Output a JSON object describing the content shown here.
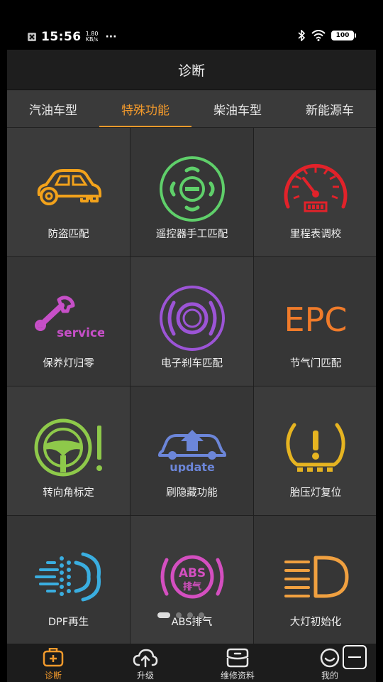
{
  "status_bar": {
    "time": "15:56",
    "speed_value": "1.80",
    "speed_unit": "KB/s",
    "more": "···",
    "battery": "100"
  },
  "header": {
    "title": "诊断"
  },
  "tabs": [
    {
      "label": "汽油车型",
      "active": false
    },
    {
      "label": "特殊功能",
      "active": true
    },
    {
      "label": "柴油车型",
      "active": false
    },
    {
      "label": "新能源车",
      "active": false
    }
  ],
  "features": [
    {
      "label": "防盗匹配",
      "icon": "car-key-icon",
      "color": "#f2a21b"
    },
    {
      "label": "遥控器手工匹配",
      "icon": "remote-control-icon",
      "color": "#5fcf6a"
    },
    {
      "label": "里程表调校",
      "icon": "odometer-icon",
      "color": "#e2222a"
    },
    {
      "label": "保养灯归零",
      "icon": "service-wrench-icon",
      "color": "#c64fc7"
    },
    {
      "label": "电子刹车匹配",
      "icon": "electronic-brake-icon",
      "color": "#9c54d6"
    },
    {
      "label": "节气门匹配",
      "icon": "epc-icon",
      "color": "#f07b2a",
      "icon_text": "EPC"
    },
    {
      "label": "转向角标定",
      "icon": "steering-wheel-icon",
      "color": "#8ec94a"
    },
    {
      "label": "刷隐藏功能",
      "icon": "car-update-icon",
      "color": "#6c86d9",
      "icon_text": "update"
    },
    {
      "label": "胎压灯复位",
      "icon": "tire-pressure-icon",
      "color": "#e6b421"
    },
    {
      "label": "DPF再生",
      "icon": "dpf-icon",
      "color": "#3aaee0"
    },
    {
      "label": "ABS排气",
      "icon": "abs-bleed-icon",
      "color": "#d44fc0",
      "icon_text": "ABS",
      "icon_subtext": "排气"
    },
    {
      "label": "大灯初始化",
      "icon": "headlight-icon",
      "color": "#f0a040"
    }
  ],
  "bottom_nav": [
    {
      "label": "诊断",
      "icon": "diagnosis-icon",
      "active": true
    },
    {
      "label": "升级",
      "icon": "cloud-upload-icon",
      "active": false
    },
    {
      "label": "维修资料",
      "icon": "repair-data-icon",
      "active": false
    },
    {
      "label": "我的",
      "icon": "profile-icon",
      "active": false
    }
  ],
  "colors": {
    "accent": "#f39a2c"
  }
}
